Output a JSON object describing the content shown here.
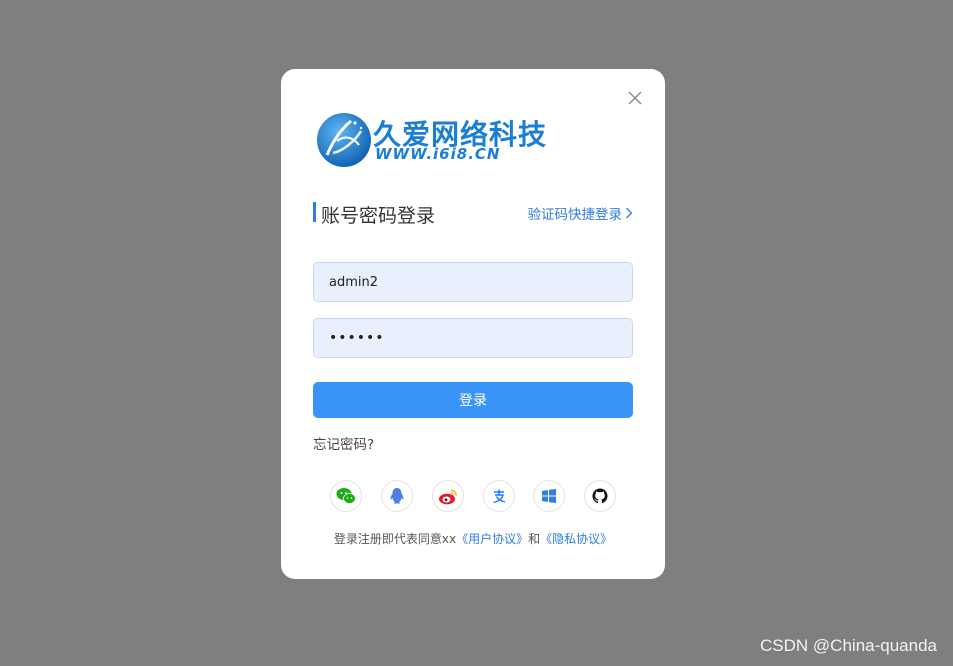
{
  "logo": {
    "name_cn": "久爱网络科技",
    "url_text": "WWW.i6i8.CN"
  },
  "login": {
    "title": "账号密码登录",
    "switch_link": "验证码快捷登录",
    "username_value": "admin2",
    "password_masked": "••••••",
    "submit_label": "登录",
    "forgot_label": "忘记密码?"
  },
  "social_icons": [
    "wechat-icon",
    "qq-icon",
    "weibo-icon",
    "alipay-icon",
    "windows-icon",
    "github-icon"
  ],
  "agreement": {
    "prefix": "登录注册即代表同意xx",
    "user_agreement": "《用户协议》",
    "and": "和",
    "privacy_agreement": "《隐私协议》"
  },
  "watermark": "CSDN @China-quanda",
  "colors": {
    "overlay": "#7f7f7f",
    "accent": "#3a93f6",
    "link": "#2f7de1",
    "input_bg": "#e8f0fe"
  }
}
